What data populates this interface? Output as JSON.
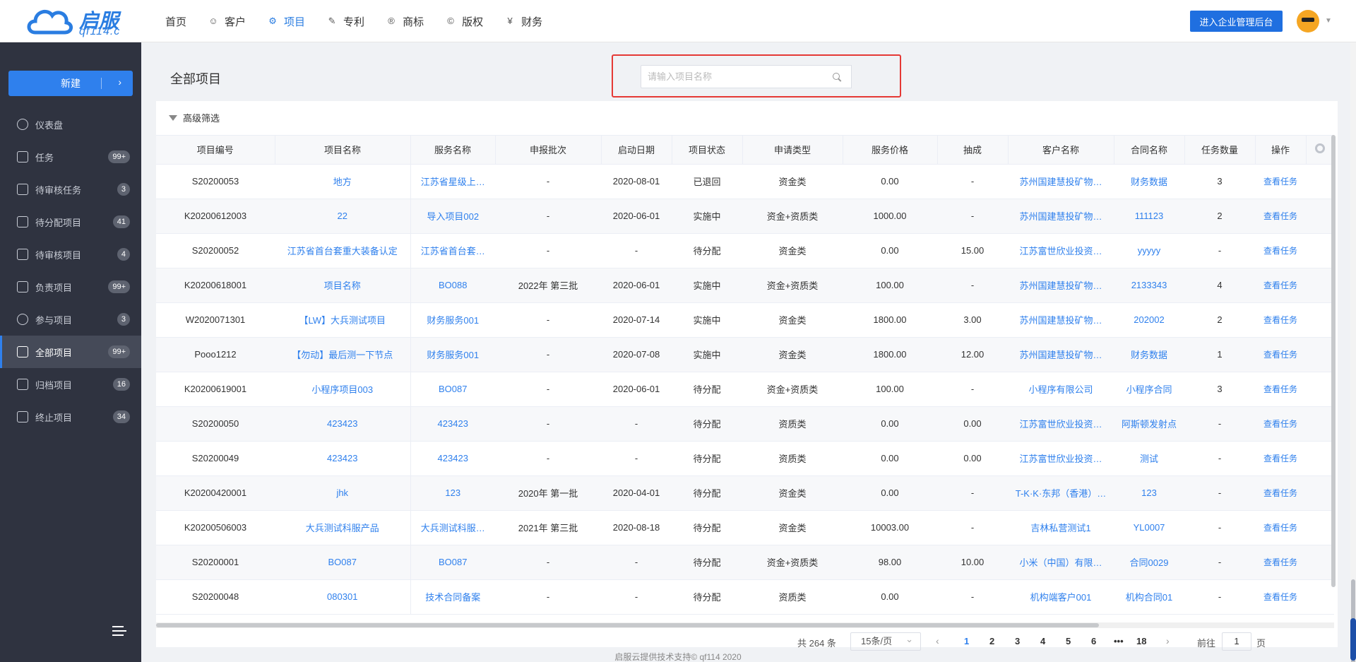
{
  "logo": {
    "text": "启服",
    "sub": "qf114.c"
  },
  "nav": [
    {
      "label": "首页",
      "icon": ""
    },
    {
      "label": "客户",
      "icon": "user-icon"
    },
    {
      "label": "项目",
      "icon": "project-icon",
      "active": true
    },
    {
      "label": "专利",
      "icon": "patent-icon"
    },
    {
      "label": "商标",
      "icon": "trademark-icon"
    },
    {
      "label": "版权",
      "icon": "copyright-icon"
    },
    {
      "label": "财务",
      "icon": "finance-icon"
    }
  ],
  "enter_admin": "进入企业管理后台",
  "sidebar": {
    "new_label": "新建",
    "items": [
      {
        "label": "仪表盘",
        "badge": "",
        "icon": "dashboard-icon"
      },
      {
        "label": "任务",
        "badge": "99+",
        "icon": "task-icon"
      },
      {
        "label": "待审核任务",
        "badge": "3",
        "icon": "pending-task-icon"
      },
      {
        "label": "待分配项目",
        "badge": "41",
        "icon": "assign-icon"
      },
      {
        "label": "待审核项目",
        "badge": "4",
        "icon": "review-icon"
      },
      {
        "label": "负责项目",
        "badge": "99+",
        "icon": "responsible-icon"
      },
      {
        "label": "参与项目",
        "badge": "3",
        "icon": "participate-icon"
      },
      {
        "label": "全部项目",
        "badge": "99+",
        "icon": "all-projects-icon",
        "active": true
      },
      {
        "label": "归档项目",
        "badge": "16",
        "icon": "archive-icon"
      },
      {
        "label": "终止项目",
        "badge": "34",
        "icon": "trash-icon"
      }
    ]
  },
  "main": {
    "title": "全部项目",
    "search_placeholder": "请输入项目名称",
    "filter_label": "高级筛选"
  },
  "table": {
    "columns": [
      "项目编号",
      "项目名称",
      "服务名称",
      "申报批次",
      "启动日期",
      "项目状态",
      "申请类型",
      "服务价格",
      "抽成",
      "客户名称",
      "合同名称",
      "任务数量",
      "操作"
    ],
    "op_label": "查看任务",
    "rows": [
      [
        "S20200053",
        "地方",
        "江苏省星级上…",
        "-",
        "2020-08-01",
        "已退回",
        "资金类",
        "0.00",
        "-",
        "苏州国建慧投矿物…",
        "财务数据",
        "3"
      ],
      [
        "K20200612003",
        "22",
        "导入项目002",
        "-",
        "2020-06-01",
        "实施中",
        "资金+资质类",
        "1000.00",
        "-",
        "苏州国建慧投矿物…",
        "111123",
        "2"
      ],
      [
        "S20200052",
        "江苏省首台套重大装备认定",
        "江苏省首台套…",
        "-",
        "-",
        "待分配",
        "资金类",
        "0.00",
        "15.00",
        "江苏富世欣业投资…",
        "yyyyy",
        "-"
      ],
      [
        "K20200618001",
        "项目名称",
        "BO088",
        "2022年 第三批",
        "2020-06-01",
        "实施中",
        "资金+资质类",
        "100.00",
        "-",
        "苏州国建慧投矿物…",
        "2133343",
        "4"
      ],
      [
        "W2020071301",
        "【LW】大兵测试项目",
        "财务服务001",
        "-",
        "2020-07-14",
        "实施中",
        "资金类",
        "1800.00",
        "3.00",
        "苏州国建慧投矿物…",
        "202002",
        "2"
      ],
      [
        "Pooo1212",
        "【勿动】最后测一下节点",
        "财务服务001",
        "-",
        "2020-07-08",
        "实施中",
        "资金类",
        "1800.00",
        "12.00",
        "苏州国建慧投矿物…",
        "财务数据",
        "1"
      ],
      [
        "K20200619001",
        "小程序项目003",
        "BO087",
        "-",
        "2020-06-01",
        "待分配",
        "资金+资质类",
        "100.00",
        "-",
        "小程序有限公司",
        "小程序合同",
        "3"
      ],
      [
        "S20200050",
        "423423",
        "423423",
        "-",
        "-",
        "待分配",
        "资质类",
        "0.00",
        "0.00",
        "江苏富世欣业投资…",
        "阿斯顿发射点",
        "-"
      ],
      [
        "S20200049",
        "423423",
        "423423",
        "-",
        "-",
        "待分配",
        "资质类",
        "0.00",
        "0.00",
        "江苏富世欣业投资…",
        "测试",
        "-"
      ],
      [
        "K20200420001",
        "jhk",
        "123",
        "2020年 第一批",
        "2020-04-01",
        "待分配",
        "资金类",
        "0.00",
        "-",
        "T-K·K·东邦（香港）…",
        "123",
        "-"
      ],
      [
        "K20200506003",
        "大兵测试科服产品",
        "大兵测试科服…",
        "2021年 第三批",
        "2020-08-18",
        "待分配",
        "资金类",
        "10003.00",
        "-",
        "吉林私营测试1",
        "YL0007",
        "-"
      ],
      [
        "S20200001",
        "BO087",
        "BO087",
        "-",
        "-",
        "待分配",
        "资金+资质类",
        "98.00",
        "10.00",
        "小米（中国）有限…",
        "合同0029",
        "-"
      ],
      [
        "S20200048",
        "080301",
        "技术合同备案",
        "-",
        "-",
        "待分配",
        "资质类",
        "0.00",
        "-",
        "机构端客户001",
        "机构合同01",
        "-"
      ]
    ]
  },
  "pager": {
    "total": "共 264 条",
    "page_size": "15条/页",
    "pages": [
      "1",
      "2",
      "3",
      "4",
      "5",
      "6",
      "•••",
      "18"
    ],
    "goto_prefix": "前往",
    "goto_value": "1",
    "goto_suffix": "页"
  },
  "footer": "启服云提供技术支持© qf114 2020"
}
